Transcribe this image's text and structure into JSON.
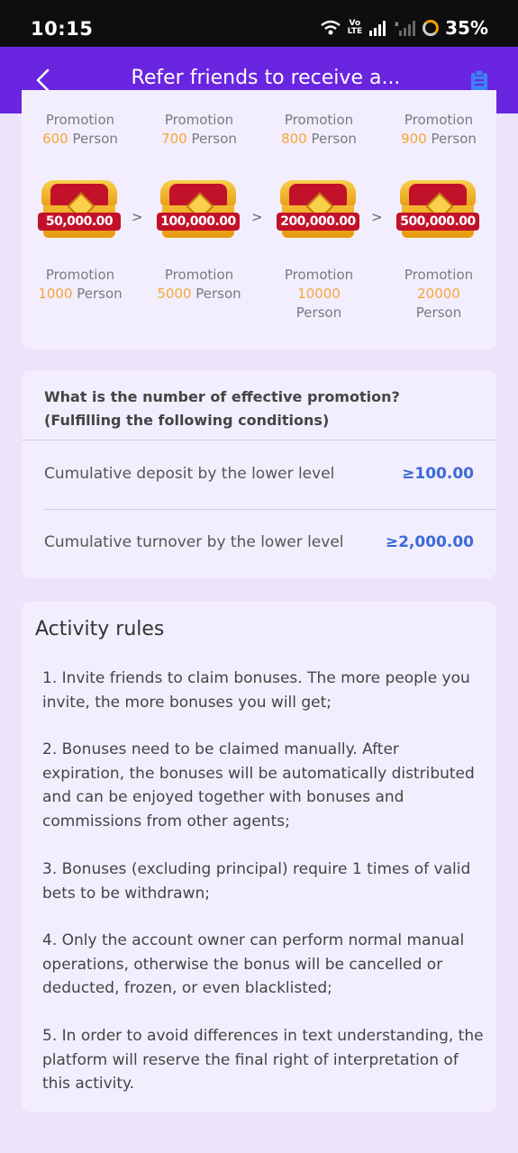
{
  "status_bar": {
    "time": "10:15",
    "volte": "Vo\nLTE",
    "battery": "35%"
  },
  "header": {
    "title": "Refer friends to receive a..."
  },
  "levels": {
    "promotion_label": "Promotion",
    "person_label": "Person",
    "separator": ">",
    "top_row": [
      {
        "count": "600"
      },
      {
        "count": "700"
      },
      {
        "count": "800"
      },
      {
        "count": "900"
      }
    ],
    "chests": [
      {
        "amount": "50,000.00",
        "count": "1000"
      },
      {
        "amount": "100,000.00",
        "count": "5000"
      },
      {
        "amount": "200,000.00",
        "count": "10000"
      },
      {
        "amount": "500,000.00",
        "count": "20000"
      }
    ]
  },
  "conditions": {
    "title": "What is the number of effective promotion? (Fulfilling the following conditions)",
    "rows": [
      {
        "label": "Cumulative deposit by the lower level",
        "value": "≥100.00"
      },
      {
        "label": "Cumulative turnover by the lower level",
        "value": "≥2,000.00"
      }
    ]
  },
  "rules": {
    "title": "Activity rules",
    "items": [
      "1. Invite friends to claim bonuses. The more people you invite, the more bonuses you will get;",
      "2. Bonuses need to be claimed manually. After expiration, the bonuses will be automatically distributed and can be enjoyed together with bonuses and commissions from other agents;",
      "3. Bonuses (excluding principal) require 1 times of valid bets to be withdrawn;",
      "4. Only the account owner can perform normal manual operations, otherwise the bonus will be cancelled or deducted, frozen, or even blacklisted;",
      "5. In order to avoid differences in text understanding, the platform will reserve the final right of interpretation of this activity."
    ]
  },
  "colors": {
    "header_bg": "#6a25e0",
    "accent_orange": "#f4a63b",
    "value_blue": "#3b6ad8",
    "page_bg": "#ede4fb"
  }
}
